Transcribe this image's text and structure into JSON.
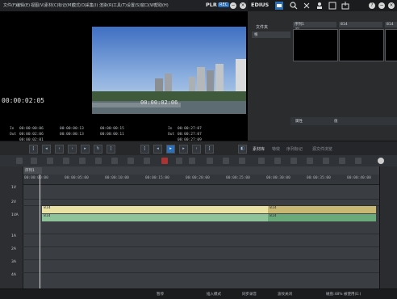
{
  "menu": {
    "items": [
      "文件(F)",
      "编辑(E)",
      "视图(V)",
      "素材(C)",
      "标记(M)",
      "模式(O)",
      "采集(I)",
      "渲染(R)",
      "工具(T)",
      "设置(S)",
      "窗口(W)",
      "帮助(H)"
    ]
  },
  "appbar": {
    "plr": "PLR",
    "rec": "REC",
    "brand": "EDIUS",
    "help_glyph": "?",
    "close_glyph": "×",
    "min_glyph": "−"
  },
  "player": {
    "timecode_main": "00:00:02:05",
    "timecode_overlay": "00:00:02:06",
    "in_label_left": "In",
    "in_value_left": "00:00:00:06",
    "out_label_left": "Out",
    "out_value_left": "00:00:02:06",
    "dur_value_left": "00:00:02:01",
    "tc_col2_top": "00:00:00:13",
    "tc_col2_bottom": "00:00:00:13",
    "tc_col3_top": "00:00:00:15",
    "tc_col3_bottom": "00:00:00:11",
    "in_label_right": "In",
    "in_value_right": "00:00:27:07",
    "out_label_right": "Out",
    "out_value_right": "00:00:27:07",
    "dur_value_right": "00:00:27:09"
  },
  "bin": {
    "folder_tab": "文件夹",
    "root_label": "根",
    "path": "根/",
    "clips": [
      {
        "label": "序列1"
      },
      {
        "label": "814"
      },
      {
        "label": "814"
      }
    ],
    "props_label": "属性",
    "props_value": "值",
    "bottom_tabs": [
      "素材库",
      "特效",
      "序列标记",
      "源文件浏览"
    ]
  },
  "timeline": {
    "sequence_tab": "序列1",
    "ruler_ticks": [
      "00:00:00:00",
      "00:00:05:00",
      "00:00:10:00",
      "00:00:15:00",
      "00:00:20:00",
      "00:00:25:00",
      "00:00:30:00",
      "00:00:35:00",
      "00:00:40:00"
    ],
    "tracks": [
      "1V",
      "2V",
      "1VA",
      "1A",
      "2A",
      "3A",
      "4A"
    ],
    "video_clip_1": "814",
    "video_clip_2": "814",
    "audio_clip_1": "814",
    "audio_clip_2": "814"
  },
  "status": {
    "left": "暂停",
    "mid1": "插入模式",
    "mid2": "同步录音",
    "mid3": "波纹关闭",
    "right": "磁盘:48% 被使用(E:)"
  },
  "colors": {
    "accent": "#2b6fb9",
    "video_clip": "#e9e2a4",
    "video_clip_selected": "#c9b873",
    "audio_clip": "#8fc49a",
    "audio_clip_2": "#6aa979"
  }
}
